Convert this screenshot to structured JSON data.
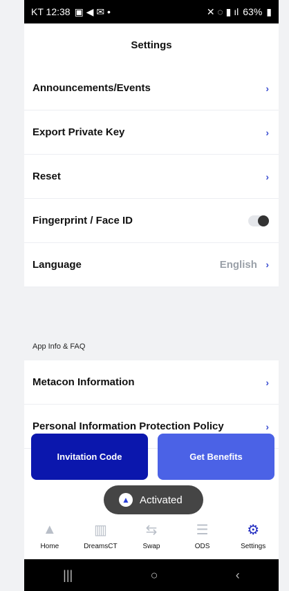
{
  "status_bar": {
    "left_text": "KT 12:38",
    "battery": "63%"
  },
  "page_title": "Settings",
  "settings": [
    {
      "label": "Announcements/Events"
    },
    {
      "label": "Export Private Key"
    },
    {
      "label": "Reset"
    },
    {
      "label": "Fingerprint / Face ID"
    },
    {
      "label": "Language",
      "value": "English"
    }
  ],
  "section_header": "App Info & FAQ",
  "info_rows": [
    {
      "label": "Metacon Information"
    },
    {
      "label": "Personal Information Protection Policy"
    }
  ],
  "buttons": {
    "invitation": "Invitation Code",
    "benefits": "Get Benefits"
  },
  "toast": "Activated",
  "tabs": [
    {
      "label": "Home",
      "icon": "home-icon"
    },
    {
      "label": "DreamsCT",
      "icon": "building-icon"
    },
    {
      "label": "Swap",
      "icon": "swap-icon"
    },
    {
      "label": "ODS",
      "icon": "server-icon"
    },
    {
      "label": "Settings",
      "icon": "gear-icon"
    }
  ],
  "colors": {
    "accent_dark": "#0b17ad",
    "accent_light": "#4b62e6",
    "chevron": "#3b4ed1"
  }
}
